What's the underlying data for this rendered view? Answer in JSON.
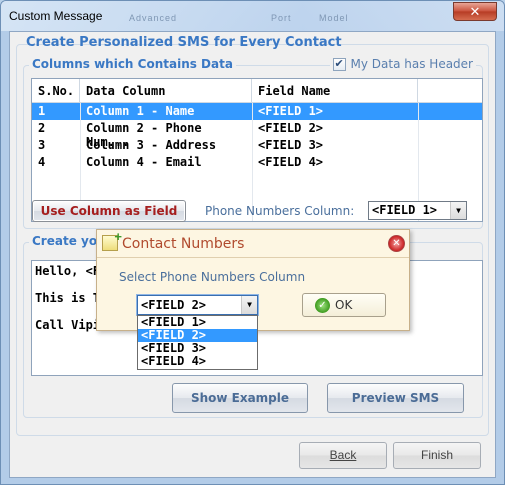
{
  "window": {
    "title": "Custom Message",
    "close_glyph": "✕",
    "ghost_menu": [
      "Advanced",
      "Port",
      "Model"
    ]
  },
  "main_title": "Create Personalized SMS for Every Contact",
  "columns_group": {
    "title": "Columns which Contains Data",
    "header_checkbox_label": "My Data has Header",
    "header_checked": true
  },
  "grid": {
    "headers": [
      "S.No.",
      "Data Column",
      "Field Name"
    ],
    "rows": [
      {
        "sno": "1",
        "column": "Column 1 - Name",
        "field": "<FIELD 1>",
        "selected": true
      },
      {
        "sno": "2",
        "column": "Column 2 - Phone Num...",
        "field": "<FIELD 2>",
        "selected": false
      },
      {
        "sno": "3",
        "column": "Column 3 - Address",
        "field": "<FIELD 3>",
        "selected": false
      },
      {
        "sno": "4",
        "column": "Column 4 - Email",
        "field": "<FIELD 4>",
        "selected": false
      }
    ]
  },
  "use_column_button": "Use Column as Field",
  "phone_column": {
    "label": "Phone Numbers Column:",
    "value": "<FIELD 1>"
  },
  "message_group": {
    "title": "Create yo",
    "lines": [
      "Hello, <FI",
      "This is Tes",
      "Call Vipin"
    ]
  },
  "show_example_button": "Show Example",
  "preview_sms_button": "Preview SMS",
  "back_button": "Back",
  "finish_button": "Finish",
  "popup": {
    "title": "Contact Numbers",
    "close_glyph": "✕",
    "label": "Select Phone Numbers Column",
    "combo_value": "<FIELD 2>",
    "ok_label": "OK",
    "ok_glyph": "✓",
    "options": [
      "<FIELD 1>",
      "<FIELD 2>",
      "<FIELD 3>",
      "<FIELD 4>"
    ],
    "selected_option": 1
  },
  "icons": {
    "dropdown_arrow": "▼"
  }
}
